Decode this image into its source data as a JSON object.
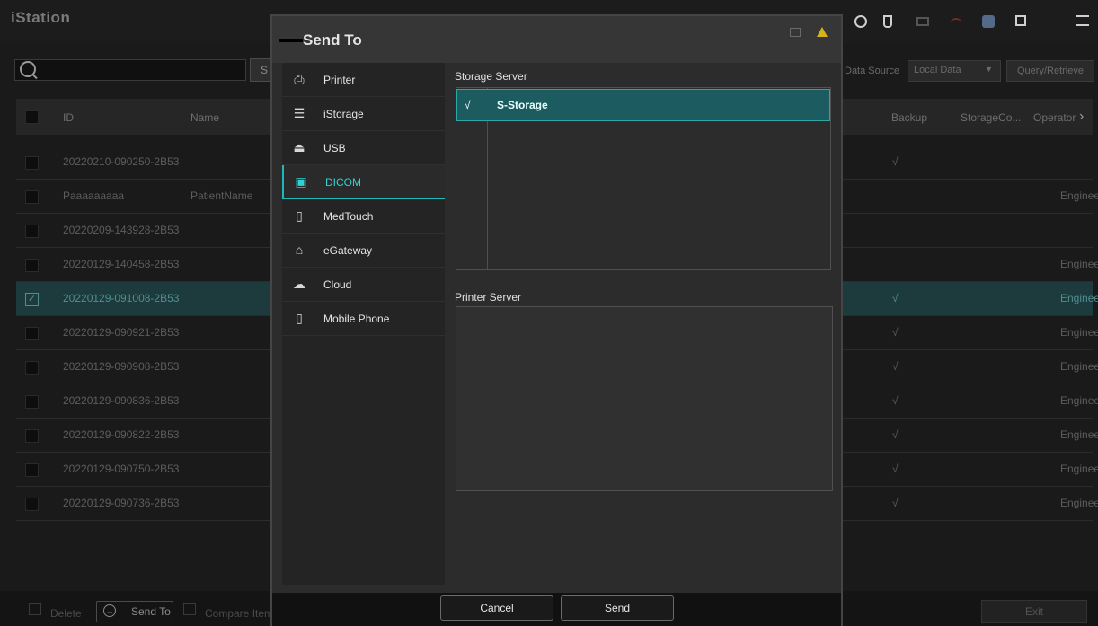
{
  "app": {
    "title": "iStation"
  },
  "search": {
    "button_label": "S"
  },
  "data_source": {
    "label": "Data Source",
    "value": "Local Data",
    "query_button": "Query/Retrieve"
  },
  "table": {
    "headers": {
      "id": "ID",
      "name": "Name",
      "backup": "Backup",
      "storage": "StorageCo...",
      "operator": "Operator"
    },
    "rows": [
      {
        "id": "20220210-090250-2B53",
        "name": "",
        "backup": "√",
        "operator": ""
      },
      {
        "id": "Paaaaaaaaa",
        "name": "PatientName",
        "backup": "",
        "operator": "Engineer"
      },
      {
        "id": "20220209-143928-2B53",
        "name": "",
        "backup": "",
        "operator": ""
      },
      {
        "id": "20220129-140458-2B53",
        "name": "",
        "backup": "",
        "operator": "Engineer"
      },
      {
        "id": "20220129-091008-2B53",
        "name": "",
        "backup": "√",
        "operator": "Engineer"
      },
      {
        "id": "20220129-090921-2B53",
        "name": "",
        "backup": "√",
        "operator": "Engineer"
      },
      {
        "id": "20220129-090908-2B53",
        "name": "",
        "backup": "√",
        "operator": "Engineer"
      },
      {
        "id": "20220129-090836-2B53",
        "name": "",
        "backup": "√",
        "operator": "Engineer"
      },
      {
        "id": "20220129-090822-2B53",
        "name": "",
        "backup": "√",
        "operator": "Engineer"
      },
      {
        "id": "20220129-090750-2B53",
        "name": "",
        "backup": "√",
        "operator": "Engineer"
      },
      {
        "id": "20220129-090736-2B53",
        "name": "",
        "backup": "√",
        "operator": "Engineer"
      }
    ]
  },
  "bottom": {
    "delete_label": "Delete",
    "send_to_label": "Send To",
    "compare_label": "Compare Item",
    "exit_label": "Exit"
  },
  "dialog": {
    "title": "Send To",
    "menu": [
      {
        "label": "Printer",
        "icon": "printer-icon",
        "glyph": "⎙"
      },
      {
        "label": "iStorage",
        "icon": "storage-icon",
        "glyph": "☰"
      },
      {
        "label": "USB",
        "icon": "usb-icon",
        "glyph": "⏏"
      },
      {
        "label": "DICOM",
        "icon": "dicom-icon",
        "glyph": "▣"
      },
      {
        "label": "MedTouch",
        "icon": "tablet-icon",
        "glyph": "▯"
      },
      {
        "label": "eGateway",
        "icon": "gateway-icon",
        "glyph": "⌂"
      },
      {
        "label": "Cloud",
        "icon": "cloud-icon",
        "glyph": "☁"
      },
      {
        "label": "Mobile Phone",
        "icon": "phone-icon",
        "glyph": "▯"
      }
    ],
    "storage_server_label": "Storage Server",
    "storage_servers": [
      {
        "check": "√",
        "name": "S-Storage"
      }
    ],
    "printer_server_label": "Printer Server",
    "cancel_label": "Cancel",
    "send_label": "Send"
  },
  "colors": {
    "accent": "#1fb8b8",
    "selected_row": "#1c5c60",
    "warning": "#d6b21c"
  }
}
